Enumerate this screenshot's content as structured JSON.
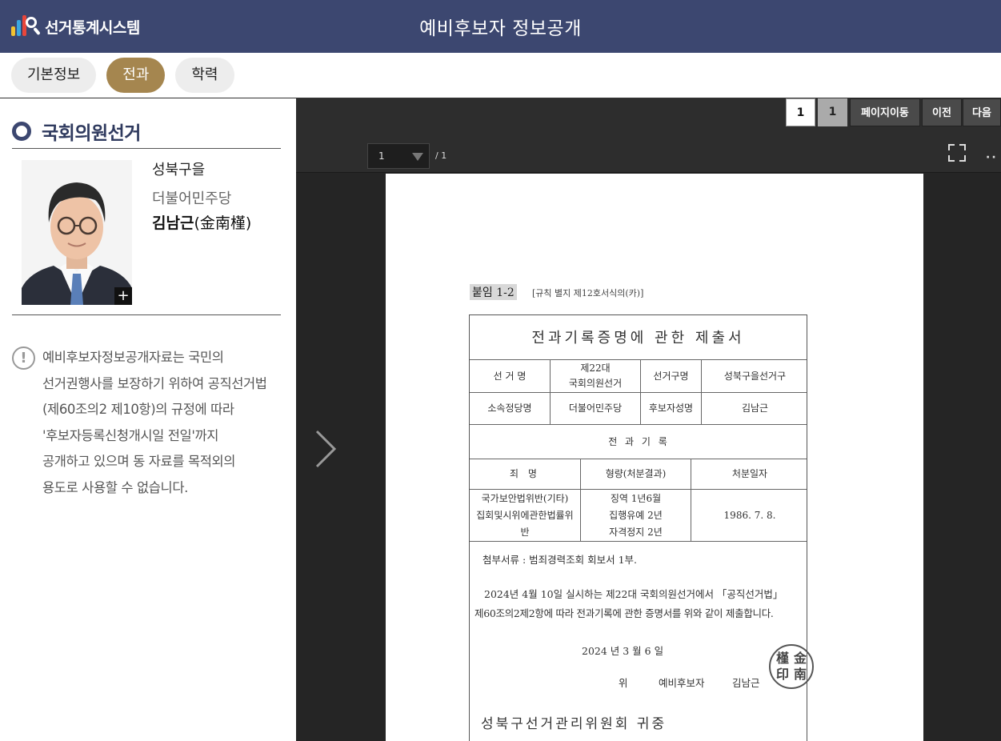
{
  "header": {
    "logo_text": "선거통계시스템",
    "title": "예비후보자 정보공개"
  },
  "tabs": [
    {
      "label": "기본정보",
      "active": false
    },
    {
      "label": "전과",
      "active": true
    },
    {
      "label": "학력",
      "active": false
    }
  ],
  "candidate": {
    "election": "국회의원선거",
    "district": "성북구을",
    "party": "더불어민주당",
    "name": "김남근",
    "name_hanja": "(金南槿)",
    "photo_expand": "+"
  },
  "notice": {
    "icon": "!",
    "lines": [
      "예비후보자정보공개자료는 국민의",
      "선거권행사를 보장하기 위하여 공직선거법",
      "(제60조의2 제10항)의 규정에 따라",
      "'후보자등록신청개시일 전일'까지",
      "공개하고 있으며 동 자료를 목적외의",
      "용도로 사용할 수 없습니다."
    ]
  },
  "viewer": {
    "current_page": "1",
    "total_pages": "1",
    "move_label": "페이지이동",
    "prev_label": "이전",
    "next_label": "다음",
    "select_value": "1",
    "of_text": "/ 1",
    "more_label": "··"
  },
  "document": {
    "attachment": "붙임 1-2",
    "rule": "[규칙 별지 제12호서식의(카)]",
    "title": "전과기록증명에 관한 제출서",
    "election_label": "선 거 명",
    "election_value_1": "제22대",
    "election_value_2": "국회의원선거",
    "district_label": "선거구명",
    "district_value": "성북구을선거구",
    "party_label": "소속정당명",
    "party_value": "더불어민주당",
    "cand_label": "후보자성명",
    "cand_value": "김남근",
    "record_header": "전 과 기 록",
    "col_crime": "죄 명",
    "col_sentence": "형량(처분결과)",
    "col_date": "처분일자",
    "crime_1": "국가보안법위반(기타)",
    "crime_2": "집회및시위에관한법률위",
    "crime_3": "반",
    "sentence_1": "징역 1년6월",
    "sentence_2": "집행유예 2년",
    "sentence_3": "자격정지 2년",
    "date_value": "1986. 7. 8.",
    "attach_docs": "첨부서류 : 범죄경력조회 회보서 1부.",
    "statement_1": "2024년 4월 10일 실시하는 제22대 국회의원선거에서 「공직선거법」",
    "statement_2": "제60조의2제2항에 따라 전과기록에 관한 증명서를 위와 같이 제출합니다.",
    "date_line": "2024 년   3 월   6 일",
    "signer_prefix": "위",
    "signer_role": "예비후보자",
    "signer_name": "김남근",
    "seal_chars": [
      "槿",
      "金",
      "印",
      "南"
    ],
    "recipient": "성북구선거관리위원회  귀중"
  }
}
